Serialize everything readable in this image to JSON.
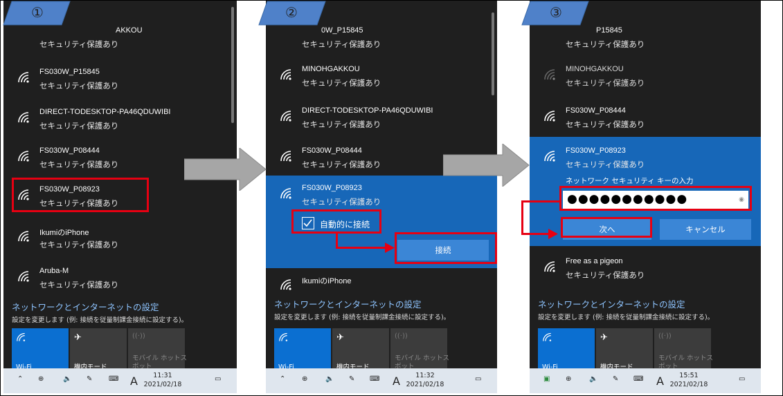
{
  "steps": [
    "①",
    "②",
    "③"
  ],
  "security_text": "セキュリティ保護あり",
  "settings": {
    "title": "ネットワークとインターネットの設定",
    "subtitle": "設定を変更します (例: 接続を従量制課金接続に設定する)。"
  },
  "tiles": {
    "wifi": "Wi-Fi",
    "airplane": "機内モード",
    "hotspot": "モバイル ホットス\nポット"
  },
  "panel1": {
    "networks": [
      {
        "name": "AKKOU"
      },
      {
        "name": "FS030W_P15845"
      },
      {
        "name": "DIRECT-TODESKTOP-PA46QDUWIBI"
      },
      {
        "name": "FS030W_P08444"
      },
      {
        "name": "FS030W_P08923"
      },
      {
        "name": "IkumiのiPhone"
      },
      {
        "name": "Aruba-M"
      }
    ],
    "time": "11:31",
    "date": "2021/02/18"
  },
  "panel2": {
    "networks": [
      {
        "name": "0W_P15845"
      },
      {
        "name": "MINOHGAKKOU"
      },
      {
        "name": "DIRECT-TODESKTOP-PA46QDUWIBI"
      },
      {
        "name": "FS030W_P08444"
      },
      {
        "name": "FS030W_P08923"
      },
      {
        "name": "IkumiのiPhone"
      }
    ],
    "auto_connect": "自動的に接続",
    "connect_button": "接続",
    "time": "11:32",
    "date": "2021/02/18"
  },
  "panel3": {
    "networks": [
      {
        "name": "P15845"
      },
      {
        "name": "MINOHGAKKOU"
      },
      {
        "name": "FS030W_P08444"
      },
      {
        "name": "FS030W_P08923"
      },
      {
        "name": "Free as a pigeon"
      }
    ],
    "key_label": "ネットワーク セキュリティ キーの入力",
    "password_mask": "●●●●●●●●●●●",
    "next_button": "次へ",
    "cancel_button": "キャンセル",
    "time": "15:51",
    "date": "2021/02/18"
  },
  "taskbar_lang": "A",
  "colors": {
    "accent": "#1767b8",
    "panel": "#1f1f1f",
    "highlight": "#e60012",
    "link": "#8ec4ff"
  }
}
